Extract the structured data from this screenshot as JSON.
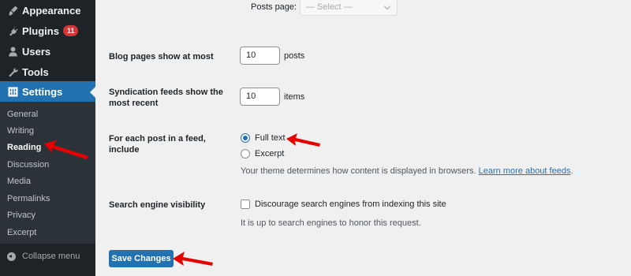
{
  "sidebar": {
    "menu": [
      {
        "label": "Appearance",
        "icon": "paintbrush-icon"
      },
      {
        "label": "Plugins",
        "icon": "plug-icon",
        "badge": "11"
      },
      {
        "label": "Users",
        "icon": "user-icon"
      },
      {
        "label": "Tools",
        "icon": "wrench-icon"
      },
      {
        "label": "Settings",
        "icon": "settings-icon",
        "active": true
      }
    ],
    "submenu": [
      "General",
      "Writing",
      "Reading",
      "Discussion",
      "Media",
      "Permalinks",
      "Privacy",
      "Excerpt"
    ],
    "current_submenu": "Reading",
    "collapse_label": "Collapse menu"
  },
  "posts_page": {
    "label": "Posts page:",
    "selected": "— Select —"
  },
  "blog_pages": {
    "label": "Blog pages show at most",
    "value": "10",
    "unit": "posts"
  },
  "syndication": {
    "label_line1": "Syndication feeds show the",
    "label_line2": "most recent",
    "value": "10",
    "unit": "items"
  },
  "feed_content": {
    "label_line1": "For each post in a feed,",
    "label_line2": "include",
    "options": [
      "Full text",
      "Excerpt"
    ],
    "selected": "Full text",
    "description": "Your theme determines how content is displayed in browsers.",
    "link_text": "Learn more about feeds"
  },
  "search_visibility": {
    "label": "Search engine visibility",
    "checkbox_label": "Discourage search engines from indexing this site",
    "checked": false,
    "note": "It is up to search engines to honor this request."
  },
  "save_button": "Save Changes",
  "colors": {
    "accent": "#2271b1",
    "sidebar": "#1d2327",
    "annotation": "#e60000"
  }
}
